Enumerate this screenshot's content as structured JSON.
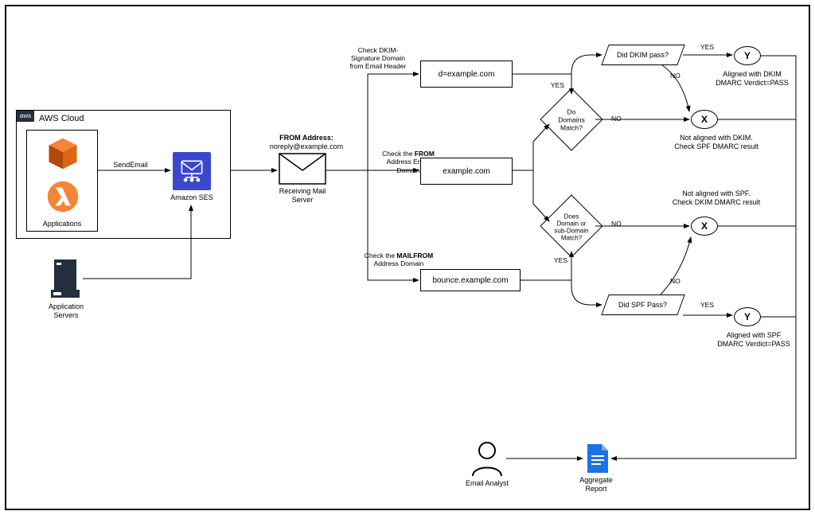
{
  "group": {
    "title": "AWS Cloud",
    "tag": "aws",
    "applications": "Applications",
    "ses": "Amazon SES",
    "send": "SendEmail"
  },
  "app_servers": "Application\nServers",
  "from": {
    "line1": "FROM Address:",
    "line2": "noreply@example.com",
    "caption": "Receiving Mail\nServer"
  },
  "checks": {
    "dkim_header": "Check DKIM-\nSignature Domain\nfrom Email Header",
    "dkim_box": "d=example.com",
    "from_domain": "Check the FROM\nAddress Email\nDomain",
    "from_box": "example.com",
    "mailfrom": "Check the MAILFROM\nAddress Domain",
    "mailfrom_box": "bounce.example.com"
  },
  "decisions": {
    "domains_match": "Do\nDomains\nMatch?",
    "subdomain_match": "Does\nDomain or\nsub-Domain\nMatch?",
    "dkim_pass": "Did DKIM pass?",
    "spf_pass": "Did SPF Pass?"
  },
  "edges": {
    "yes": "YES",
    "no": "NO"
  },
  "results": {
    "y": "Y",
    "x": "X",
    "dkim_aligned": "Aligned with DKIM\nDMARC Verdict=PASS",
    "dkim_not": "Not aligned with DKIM.\nCheck SPF DMARC result",
    "spf_not": "Not aligned with SPF.\nCheck DKIM DMARC result",
    "spf_aligned": "Aligned with SPF\nDMARC Verdict=PASS"
  },
  "bottom": {
    "analyst": "Email Analyst",
    "report": "Aggregate\nReport"
  }
}
